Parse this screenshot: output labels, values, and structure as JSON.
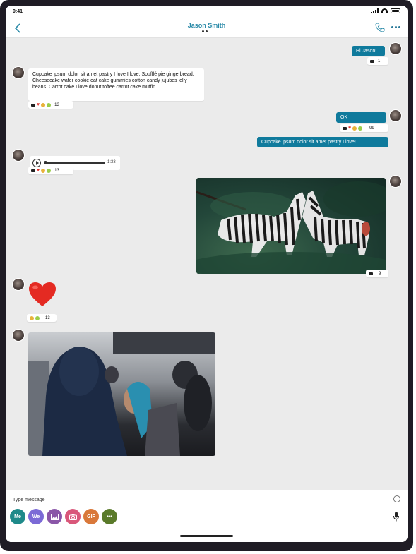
{
  "status_bar": {
    "time": "9:41"
  },
  "header": {
    "contact_name": "Jason Smith"
  },
  "messages": {
    "m1": {
      "text": "Hi Jason!",
      "reaction_count": "1"
    },
    "m2": {
      "text": "Cupcake ipsum dolor sit amet pastry I love I love. Soufflé pie gingerbread. Cheesecake wafer cookie oat cake gummies cotton candy jujubes jelly beans. Carrot cake I love donut toffee carrot cake muffin",
      "reaction_count": "13"
    },
    "m3": {
      "text": "OK",
      "reaction_count": "99"
    },
    "m4": {
      "text": "Cupcake ipsum dolor sit amet pastry I love!"
    },
    "m5": {
      "duration": "1:33",
      "reaction_count": "13"
    },
    "m6": {
      "reaction_count": "9"
    },
    "m7": {
      "reaction_count": "13"
    }
  },
  "composer": {
    "placeholder": "Type message",
    "tools": [
      {
        "label": "Me",
        "color": "#1f8a8a"
      },
      {
        "label": "We",
        "color": "#7b6ad6"
      },
      {
        "label": "",
        "icon": "image-icon",
        "color": "#8a56a8"
      },
      {
        "label": "",
        "icon": "camera-icon",
        "color": "#d9577a"
      },
      {
        "label": "GIF",
        "color": "#d9783a"
      },
      {
        "label": "•••",
        "color": "#5a7a2a"
      }
    ]
  },
  "colors": {
    "accent": "#0f7a9c",
    "title": "#2a8aa8",
    "heart": "#e0302a"
  }
}
